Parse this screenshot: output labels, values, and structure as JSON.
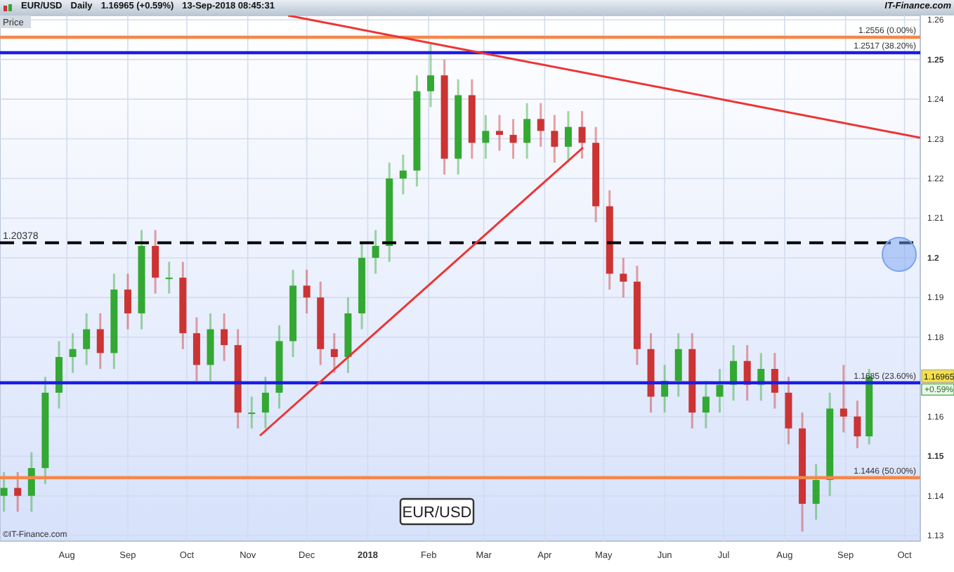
{
  "header": {
    "symbol": "EUR/USD",
    "interval": "Daily",
    "quote": "1.16965 (+0.59%)",
    "timestamp": "13-Sep-2018 08:45:31",
    "brand": "IT-Finance.com"
  },
  "chart": {
    "axis_caption": "Price",
    "copyright": "©IT-Finance.com",
    "last_price": "1.16965",
    "change": "+0.59%",
    "chart_data": {
      "type": "candlestick",
      "title": "EUR/USD",
      "grid": true,
      "xlim": [
        "2017-06-28",
        "2018-10-09"
      ],
      "ylim": [
        1.1286,
        1.2611
      ],
      "x": [
        "2017-06-30",
        "2017-07-07",
        "2017-07-14",
        "2017-07-21",
        "2017-07-28",
        "2017-08-04",
        "2017-08-11",
        "2017-08-18",
        "2017-08-25",
        "2017-09-01",
        "2017-09-08",
        "2017-09-15",
        "2017-09-22",
        "2017-09-29",
        "2017-10-06",
        "2017-10-13",
        "2017-10-20",
        "2017-10-27",
        "2017-11-03",
        "2017-11-10",
        "2017-11-17",
        "2017-11-24",
        "2017-12-01",
        "2017-12-08",
        "2017-12-15",
        "2017-12-22",
        "2017-12-29",
        "2018-01-05",
        "2018-01-12",
        "2018-01-19",
        "2018-01-26",
        "2018-02-02",
        "2018-02-09",
        "2018-02-16",
        "2018-02-23",
        "2018-03-02",
        "2018-03-09",
        "2018-03-16",
        "2018-03-23",
        "2018-03-30",
        "2018-04-06",
        "2018-04-13",
        "2018-04-20",
        "2018-04-27",
        "2018-05-04",
        "2018-05-11",
        "2018-05-18",
        "2018-05-25",
        "2018-06-01",
        "2018-06-08",
        "2018-06-15",
        "2018-06-22",
        "2018-06-29",
        "2018-07-06",
        "2018-07-13",
        "2018-07-20",
        "2018-07-27",
        "2018-08-03",
        "2018-08-10",
        "2018-08-17",
        "2018-08-24",
        "2018-08-31",
        "2018-09-07",
        "2018-09-13"
      ],
      "ohlc": [
        [
          1.14,
          1.146,
          1.136,
          1.142
        ],
        [
          1.142,
          1.146,
          1.136,
          1.14
        ],
        [
          1.14,
          1.151,
          1.136,
          1.147
        ],
        [
          1.147,
          1.17,
          1.143,
          1.166
        ],
        [
          1.166,
          1.179,
          1.162,
          1.175
        ],
        [
          1.175,
          1.181,
          1.171,
          1.177
        ],
        [
          1.177,
          1.186,
          1.173,
          1.182
        ],
        [
          1.182,
          1.186,
          1.172,
          1.176
        ],
        [
          1.176,
          1.196,
          1.172,
          1.192
        ],
        [
          1.192,
          1.196,
          1.182,
          1.186
        ],
        [
          1.186,
          1.207,
          1.182,
          1.203
        ],
        [
          1.203,
          1.207,
          1.191,
          1.195
        ],
        [
          1.195,
          1.199,
          1.191,
          1.195
        ],
        [
          1.195,
          1.199,
          1.177,
          1.181
        ],
        [
          1.181,
          1.185,
          1.169,
          1.173
        ],
        [
          1.173,
          1.186,
          1.169,
          1.182
        ],
        [
          1.182,
          1.186,
          1.174,
          1.178
        ],
        [
          1.178,
          1.182,
          1.157,
          1.161
        ],
        [
          1.161,
          1.165,
          1.157,
          1.161
        ],
        [
          1.161,
          1.17,
          1.157,
          1.166
        ],
        [
          1.166,
          1.183,
          1.162,
          1.179
        ],
        [
          1.179,
          1.197,
          1.175,
          1.193
        ],
        [
          1.193,
          1.197,
          1.186,
          1.19
        ],
        [
          1.19,
          1.194,
          1.173,
          1.177
        ],
        [
          1.177,
          1.181,
          1.171,
          1.175
        ],
        [
          1.175,
          1.19,
          1.171,
          1.186
        ],
        [
          1.186,
          1.204,
          1.182,
          1.2
        ],
        [
          1.2,
          1.207,
          1.196,
          1.203
        ],
        [
          1.203,
          1.224,
          1.199,
          1.22
        ],
        [
          1.22,
          1.226,
          1.216,
          1.222
        ],
        [
          1.222,
          1.246,
          1.218,
          1.242
        ],
        [
          1.242,
          1.254,
          1.238,
          1.246
        ],
        [
          1.246,
          1.25,
          1.221,
          1.225
        ],
        [
          1.225,
          1.245,
          1.221,
          1.241
        ],
        [
          1.241,
          1.245,
          1.225,
          1.229
        ],
        [
          1.229,
          1.236,
          1.225,
          1.232
        ],
        [
          1.232,
          1.236,
          1.227,
          1.231
        ],
        [
          1.231,
          1.235,
          1.225,
          1.229
        ],
        [
          1.229,
          1.239,
          1.225,
          1.235
        ],
        [
          1.235,
          1.239,
          1.228,
          1.232
        ],
        [
          1.232,
          1.236,
          1.224,
          1.228
        ],
        [
          1.228,
          1.237,
          1.224,
          1.233
        ],
        [
          1.233,
          1.237,
          1.225,
          1.229
        ],
        [
          1.229,
          1.233,
          1.209,
          1.213
        ],
        [
          1.213,
          1.217,
          1.192,
          1.196
        ],
        [
          1.196,
          1.2,
          1.19,
          1.194
        ],
        [
          1.194,
          1.198,
          1.173,
          1.177
        ],
        [
          1.177,
          1.181,
          1.161,
          1.165
        ],
        [
          1.165,
          1.173,
          1.161,
          1.169
        ],
        [
          1.169,
          1.181,
          1.165,
          1.177
        ],
        [
          1.177,
          1.181,
          1.157,
          1.161
        ],
        [
          1.161,
          1.169,
          1.157,
          1.165
        ],
        [
          1.165,
          1.172,
          1.161,
          1.168
        ],
        [
          1.168,
          1.178,
          1.164,
          1.174
        ],
        [
          1.174,
          1.178,
          1.164,
          1.168
        ],
        [
          1.168,
          1.176,
          1.164,
          1.172
        ],
        [
          1.172,
          1.176,
          1.162,
          1.166
        ],
        [
          1.166,
          1.17,
          1.153,
          1.157
        ],
        [
          1.157,
          1.161,
          1.131,
          1.138
        ],
        [
          1.138,
          1.148,
          1.134,
          1.144
        ],
        [
          1.144,
          1.166,
          1.14,
          1.162
        ],
        [
          1.162,
          1.173,
          1.156,
          1.16
        ],
        [
          1.16,
          1.164,
          1.152,
          1.155
        ],
        [
          1.155,
          1.172,
          1.153,
          1.17
        ]
      ],
      "xticks": [
        {
          "value": "2017-08-01",
          "label": "Aug"
        },
        {
          "value": "2017-09-01",
          "label": "Sep"
        },
        {
          "value": "2017-10-01",
          "label": "Oct"
        },
        {
          "value": "2017-11-01",
          "label": "Nov"
        },
        {
          "value": "2017-12-01",
          "label": "Dec"
        },
        {
          "value": "2018-01-01",
          "label": "2018"
        },
        {
          "value": "2018-02-01",
          "label": "Feb"
        },
        {
          "value": "2018-03-01",
          "label": "Mar"
        },
        {
          "value": "2018-04-01",
          "label": "Apr"
        },
        {
          "value": "2018-05-01",
          "label": "May"
        },
        {
          "value": "2018-06-01",
          "label": "Jun"
        },
        {
          "value": "2018-07-01",
          "label": "Jul"
        },
        {
          "value": "2018-08-01",
          "label": "Aug"
        },
        {
          "value": "2018-09-01",
          "label": "Sep"
        },
        {
          "value": "2018-10-01",
          "label": "Oct"
        }
      ],
      "yticks": [
        {
          "value": 1.26,
          "label": "1.26"
        },
        {
          "value": 1.25,
          "label": "1.25"
        },
        {
          "value": 1.24,
          "label": "1.24"
        },
        {
          "value": 1.23,
          "label": "1.23"
        },
        {
          "value": 1.22,
          "label": "1.22"
        },
        {
          "value": 1.21,
          "label": "1.21"
        },
        {
          "value": 1.2,
          "label": "1.2"
        },
        {
          "value": 1.19,
          "label": "1.19"
        },
        {
          "value": 1.18,
          "label": "1.18"
        },
        {
          "value": 1.16,
          "label": "1.16"
        },
        {
          "value": 1.15,
          "label": "1.15"
        },
        {
          "value": 1.14,
          "label": "1.14"
        },
        {
          "value": 1.13,
          "label": "1.13"
        }
      ],
      "ref_lines": [
        {
          "axis": "y",
          "value": 1.2556,
          "label": "1.2556 (0.00%)",
          "color": "#f5874a"
        },
        {
          "axis": "y",
          "value": 1.2517,
          "label": "1.2517 (38.20%)",
          "color": "#1c1ce8"
        },
        {
          "axis": "y",
          "value": 1.20378,
          "label": "1.20378",
          "color": "#000000"
        },
        {
          "axis": "y",
          "value": 1.1685,
          "label": "1.1685 (23.60%)",
          "color": "#1c1ce8"
        },
        {
          "axis": "y",
          "value": 1.1446,
          "label": "1.1446 (50.00%)",
          "color": "#f5874a"
        }
      ]
    }
  }
}
